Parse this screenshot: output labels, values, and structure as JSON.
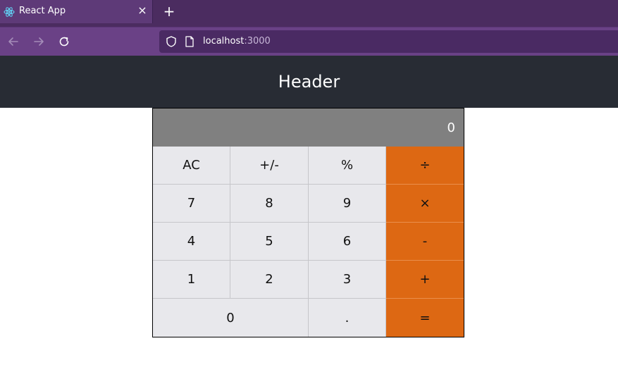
{
  "browser": {
    "tab_title": "React App",
    "close_glyph": "×",
    "new_tab_glyph": "+",
    "url_host": "localhost",
    "url_port": ":3000"
  },
  "header": {
    "title": "Header"
  },
  "calculator": {
    "display_value": "0",
    "keys": {
      "ac": "AC",
      "sign": "+/-",
      "percent": "%",
      "divide": "÷",
      "seven": "7",
      "eight": "8",
      "nine": "9",
      "multiply": "×",
      "four": "4",
      "five": "5",
      "six": "6",
      "minus": "-",
      "one": "1",
      "two": "2",
      "three": "3",
      "plus": "+",
      "zero": "0",
      "decimal": ".",
      "equals": "="
    }
  },
  "colors": {
    "tabbar": "#4b2c60",
    "navbar": "#6a4186",
    "header_bg": "#282c34",
    "display_bg": "#808080",
    "key_bg": "#e8e8ec",
    "operator_bg": "#dd6813"
  }
}
